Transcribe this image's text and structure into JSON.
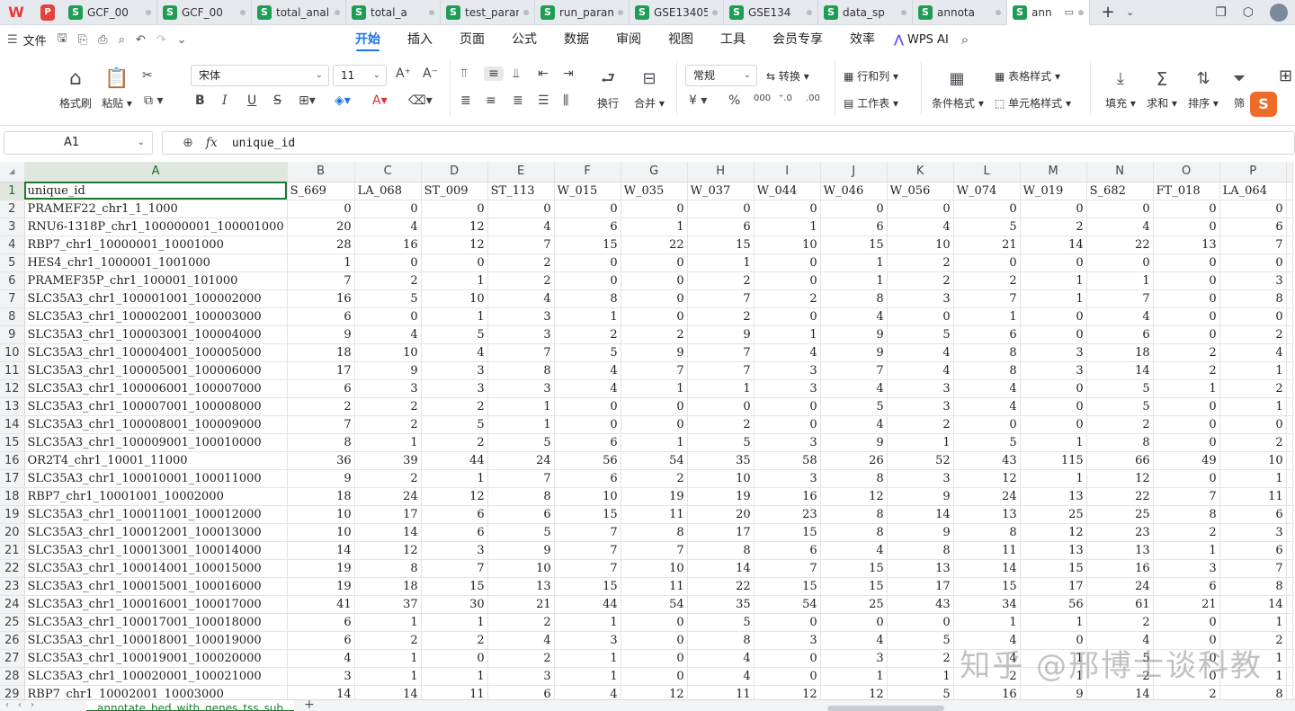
{
  "tabs": [
    {
      "label": "GCF_00",
      "active": false
    },
    {
      "label": "GCF_00",
      "active": false
    },
    {
      "label": "total_anal",
      "active": false
    },
    {
      "label": "total_a",
      "active": false
    },
    {
      "label": "test_param",
      "active": false
    },
    {
      "label": "run_param",
      "active": false
    },
    {
      "label": "GSE13405",
      "active": false
    },
    {
      "label": "GSE134",
      "active": false
    },
    {
      "label": "data_sp",
      "active": false
    },
    {
      "label": "annota",
      "active": false
    },
    {
      "label": "ann",
      "active": true
    }
  ],
  "menubar": {
    "file": "文件",
    "items": [
      "开始",
      "插入",
      "页面",
      "公式",
      "数据",
      "审阅",
      "视图",
      "工具",
      "会员专享",
      "效率"
    ],
    "active": "开始",
    "wps_ai": "WPS AI"
  },
  "ribbon": {
    "format_painter": "格式刷",
    "paste": "粘贴",
    "font_name": "宋体",
    "font_size": "11",
    "wrap": "换行",
    "merge": "合并",
    "number_format": "常规",
    "convert": "转换",
    "rows_cols": "行和列",
    "worksheet": "工作表",
    "cond_format": "条件格式",
    "table_style": "表格样式",
    "cell_style": "单元格样式",
    "fill": "填充",
    "sum": "求和",
    "sort": "排序",
    "filter": "筛",
    "bold": "B",
    "italic": "I",
    "underline": "U",
    "strike": "S",
    "yuan": "¥",
    "percent": "%"
  },
  "formula_bar": {
    "name_box": "A1",
    "value": "unique_id"
  },
  "columns": [
    "A",
    "B",
    "C",
    "D",
    "E",
    "F",
    "G",
    "H",
    "I",
    "J",
    "K",
    "L",
    "M",
    "N",
    "O",
    "P"
  ],
  "header_row": [
    "unique_id",
    "S_669",
    "LA_068",
    "ST_009",
    "ST_113",
    "W_015",
    "W_035",
    "W_037",
    "W_044",
    "W_046",
    "W_056",
    "W_074",
    "W_019",
    "S_682",
    "FT_018",
    "LA_064"
  ],
  "rows": [
    [
      "PRAMEF22_chr1_1_1000",
      "0",
      "0",
      "0",
      "0",
      "0",
      "0",
      "0",
      "0",
      "0",
      "0",
      "0",
      "0",
      "0",
      "0",
      "0"
    ],
    [
      "RNU6-1318P_chr1_100000001_100001000",
      "20",
      "4",
      "12",
      "4",
      "6",
      "1",
      "6",
      "1",
      "6",
      "4",
      "5",
      "2",
      "4",
      "0",
      "6"
    ],
    [
      "RBP7_chr1_10000001_10001000",
      "28",
      "16",
      "12",
      "7",
      "15",
      "22",
      "15",
      "10",
      "15",
      "10",
      "21",
      "14",
      "22",
      "13",
      "7"
    ],
    [
      "HES4_chr1_1000001_1001000",
      "1",
      "0",
      "0",
      "2",
      "0",
      "0",
      "1",
      "0",
      "1",
      "2",
      "0",
      "0",
      "0",
      "0",
      "0"
    ],
    [
      "PRAMEF35P_chr1_100001_101000",
      "7",
      "2",
      "1",
      "2",
      "0",
      "0",
      "2",
      "0",
      "1",
      "2",
      "2",
      "1",
      "1",
      "0",
      "3"
    ],
    [
      "SLC35A3_chr1_100001001_100002000",
      "16",
      "5",
      "10",
      "4",
      "8",
      "0",
      "7",
      "2",
      "8",
      "3",
      "7",
      "1",
      "7",
      "0",
      "8"
    ],
    [
      "SLC35A3_chr1_100002001_100003000",
      "6",
      "0",
      "1",
      "3",
      "1",
      "0",
      "2",
      "0",
      "4",
      "0",
      "1",
      "0",
      "4",
      "0",
      "0"
    ],
    [
      "SLC35A3_chr1_100003001_100004000",
      "9",
      "4",
      "5",
      "3",
      "2",
      "2",
      "9",
      "1",
      "9",
      "5",
      "6",
      "0",
      "6",
      "0",
      "2"
    ],
    [
      "SLC35A3_chr1_100004001_100005000",
      "18",
      "10",
      "4",
      "7",
      "5",
      "9",
      "7",
      "4",
      "9",
      "4",
      "8",
      "3",
      "18",
      "2",
      "4"
    ],
    [
      "SLC35A3_chr1_100005001_100006000",
      "17",
      "9",
      "3",
      "8",
      "4",
      "7",
      "7",
      "3",
      "7",
      "4",
      "8",
      "3",
      "14",
      "2",
      "1"
    ],
    [
      "SLC35A3_chr1_100006001_100007000",
      "6",
      "3",
      "3",
      "3",
      "4",
      "1",
      "1",
      "3",
      "4",
      "3",
      "4",
      "0",
      "5",
      "1",
      "2"
    ],
    [
      "SLC35A3_chr1_100007001_100008000",
      "2",
      "2",
      "2",
      "1",
      "0",
      "0",
      "0",
      "0",
      "5",
      "3",
      "4",
      "0",
      "5",
      "0",
      "1"
    ],
    [
      "SLC35A3_chr1_100008001_100009000",
      "7",
      "2",
      "5",
      "1",
      "0",
      "0",
      "2",
      "0",
      "4",
      "2",
      "0",
      "0",
      "2",
      "0",
      "0"
    ],
    [
      "SLC35A3_chr1_100009001_100010000",
      "8",
      "1",
      "2",
      "5",
      "6",
      "1",
      "5",
      "3",
      "9",
      "1",
      "5",
      "1",
      "8",
      "0",
      "2"
    ],
    [
      "OR2T4_chr1_10001_11000",
      "36",
      "39",
      "44",
      "24",
      "56",
      "54",
      "35",
      "58",
      "26",
      "52",
      "43",
      "115",
      "66",
      "49",
      "10"
    ],
    [
      "SLC35A3_chr1_100010001_100011000",
      "9",
      "2",
      "1",
      "7",
      "6",
      "2",
      "10",
      "3",
      "8",
      "3",
      "12",
      "1",
      "12",
      "0",
      "1"
    ],
    [
      "RBP7_chr1_10001001_10002000",
      "18",
      "24",
      "12",
      "8",
      "10",
      "19",
      "19",
      "16",
      "12",
      "9",
      "24",
      "13",
      "22",
      "7",
      "11"
    ],
    [
      "SLC35A3_chr1_100011001_100012000",
      "10",
      "17",
      "6",
      "6",
      "15",
      "11",
      "20",
      "23",
      "8",
      "14",
      "13",
      "25",
      "25",
      "8",
      "6"
    ],
    [
      "SLC35A3_chr1_100012001_100013000",
      "10",
      "14",
      "6",
      "5",
      "7",
      "8",
      "17",
      "15",
      "8",
      "9",
      "8",
      "12",
      "23",
      "2",
      "3"
    ],
    [
      "SLC35A3_chr1_100013001_100014000",
      "14",
      "12",
      "3",
      "9",
      "7",
      "7",
      "8",
      "6",
      "4",
      "8",
      "11",
      "13",
      "13",
      "1",
      "6"
    ],
    [
      "SLC35A3_chr1_100014001_100015000",
      "19",
      "8",
      "7",
      "10",
      "7",
      "10",
      "14",
      "7",
      "15",
      "13",
      "14",
      "15",
      "16",
      "3",
      "7"
    ],
    [
      "SLC35A3_chr1_100015001_100016000",
      "19",
      "18",
      "15",
      "13",
      "15",
      "11",
      "22",
      "15",
      "15",
      "17",
      "15",
      "17",
      "24",
      "6",
      "8"
    ],
    [
      "SLC35A3_chr1_100016001_100017000",
      "41",
      "37",
      "30",
      "21",
      "44",
      "54",
      "35",
      "54",
      "25",
      "43",
      "34",
      "56",
      "61",
      "21",
      "14"
    ],
    [
      "SLC35A3_chr1_100017001_100018000",
      "6",
      "1",
      "1",
      "2",
      "1",
      "0",
      "5",
      "0",
      "0",
      "0",
      "1",
      "1",
      "2",
      "0",
      "1"
    ],
    [
      "SLC35A3_chr1_100018001_100019000",
      "6",
      "2",
      "2",
      "4",
      "3",
      "0",
      "8",
      "3",
      "4",
      "5",
      "4",
      "0",
      "4",
      "0",
      "2"
    ],
    [
      "SLC35A3_chr1_100019001_100020000",
      "4",
      "1",
      "0",
      "2",
      "1",
      "0",
      "4",
      "0",
      "3",
      "2",
      "4",
      "1",
      "5",
      "0",
      "1"
    ],
    [
      "SLC35A3_chr1_100020001_100021000",
      "3",
      "1",
      "1",
      "3",
      "1",
      "0",
      "4",
      "0",
      "1",
      "1",
      "2",
      "1",
      "2",
      "0",
      "1"
    ],
    [
      "RBP7_chr1_10002001_10003000",
      "14",
      "14",
      "11",
      "6",
      "4",
      "12",
      "11",
      "12",
      "12",
      "5",
      "16",
      "9",
      "14",
      "2",
      "8"
    ]
  ],
  "sheet_tab": "annotate_bed_with_genes_tss_sub",
  "watermark": "知乎 @邢博士谈科教",
  "colors": {
    "accent": "#1a73e8",
    "selection": "#1e7a32",
    "sheet_icon": "#1f9d55"
  }
}
